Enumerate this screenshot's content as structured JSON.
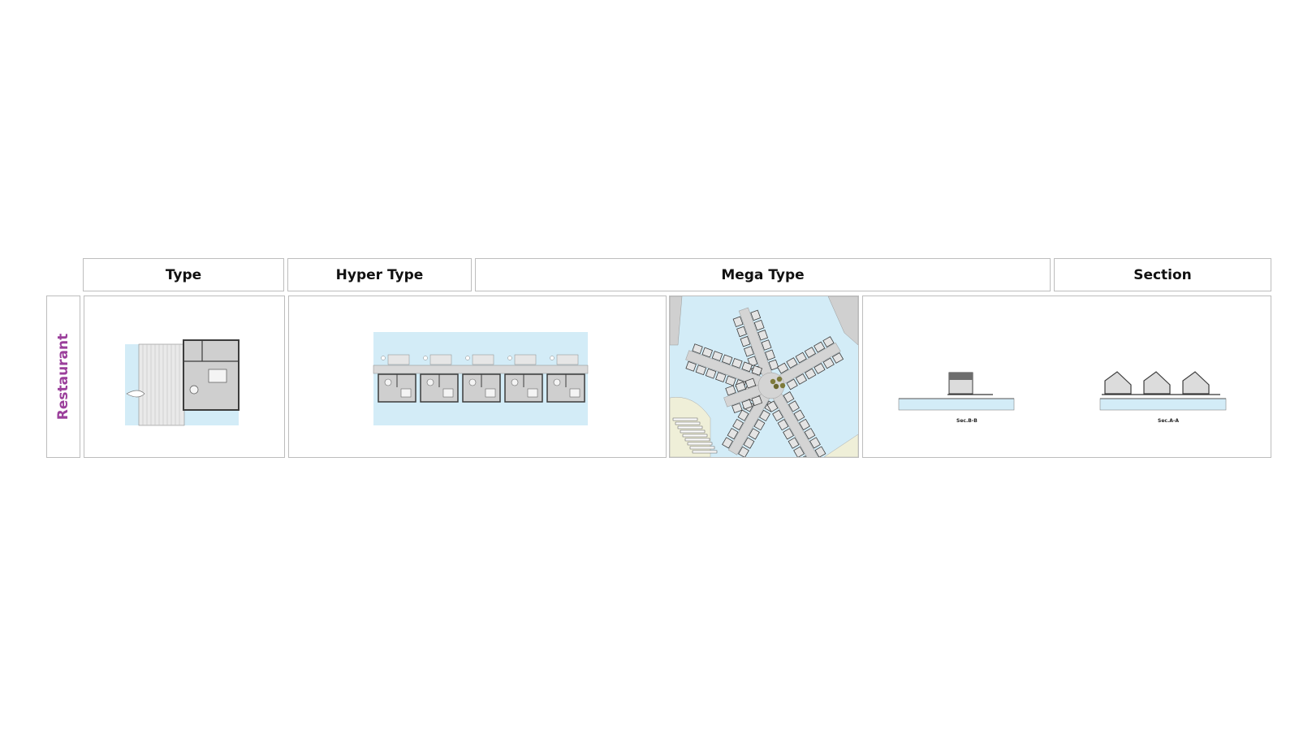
{
  "headers": {
    "type": "Type",
    "hyper_type": "Hyper Type",
    "mega_type": "Mega Type",
    "section": "Section"
  },
  "row": {
    "label": "Restaurant"
  },
  "sections": {
    "b": "Sec.B-B",
    "a": "Sec.A-A"
  },
  "colors": {
    "row_label": "#9b3f9b",
    "water": "#d3ecf7",
    "land": "#efefd8",
    "deck": "#d9d9d9",
    "wall": "#3c3c3c",
    "border": "#bdbdbd"
  }
}
